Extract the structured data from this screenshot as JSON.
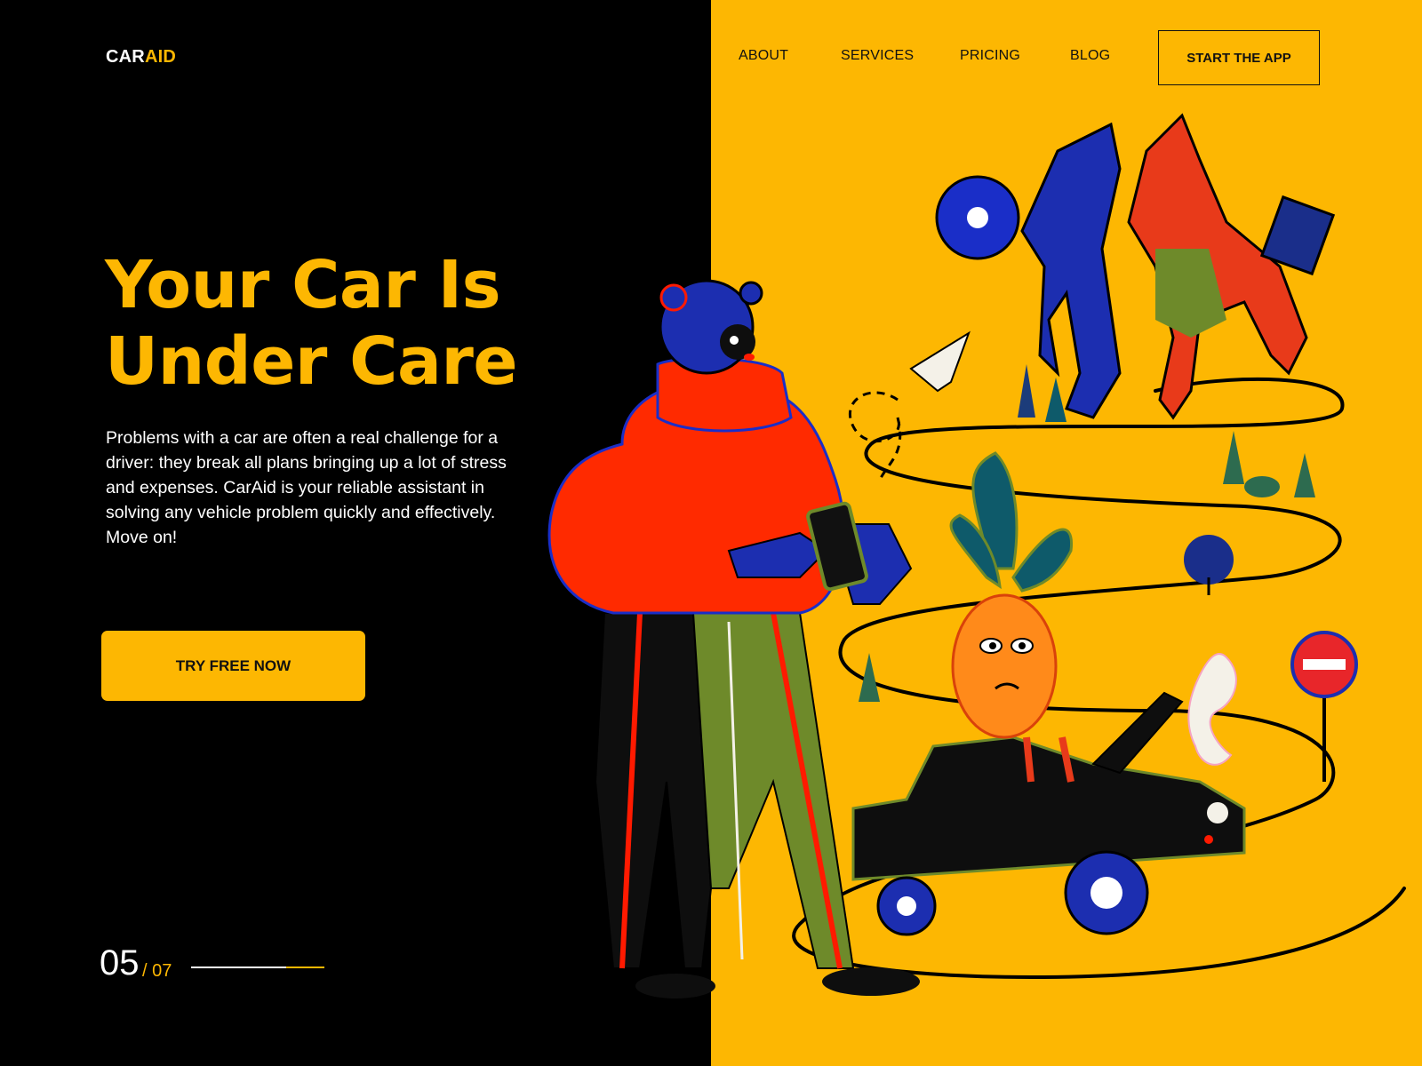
{
  "brand": {
    "part1": "CAR",
    "part2": "AID"
  },
  "nav": {
    "items": [
      "ABOUT",
      "SERVICES",
      "PRICING",
      "BLOG"
    ],
    "cta": "START THE APP"
  },
  "hero": {
    "title_line1": "Your Car Is",
    "title_line2": "Under Care",
    "body": "Problems with a car are often a real challenge for a driver: they break all plans bringing up a lot of stress and expenses. CarAid is your reliable assistant in solving any vehicle problem quickly and effectively. Move on!",
    "button": "TRY FREE NOW"
  },
  "pager": {
    "current": "05",
    "total": "/ 07",
    "progress": 0.71
  },
  "colors": {
    "accent": "#FDB702",
    "dark": "#000000",
    "ink": "#111111"
  },
  "illustration": {
    "icons": [
      "bear-character-icon",
      "smartphone-icon",
      "paper-plane-icon",
      "pineapple-character-icon",
      "black-car-icon",
      "no-entry-sign-icon",
      "mechanic-dogs-icon",
      "road-icon",
      "tree-icon"
    ]
  }
}
